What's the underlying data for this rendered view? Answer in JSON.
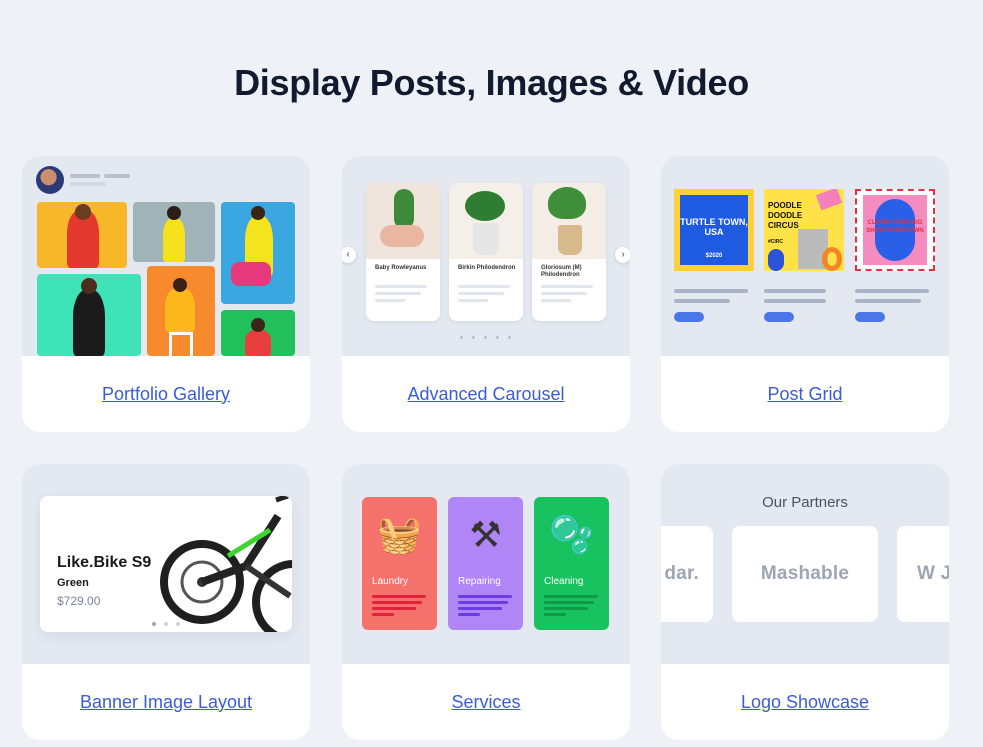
{
  "page": {
    "title": "Display Posts, Images & Video"
  },
  "cards": [
    {
      "label": "Portfolio Gallery"
    },
    {
      "label": "Advanced Carousel"
    },
    {
      "label": "Post Grid"
    },
    {
      "label": "Banner Image Layout"
    },
    {
      "label": "Services"
    },
    {
      "label": "Logo Showcase"
    }
  ],
  "carousel": {
    "plants": [
      {
        "name": "Baby Rowleyanus"
      },
      {
        "name": "Birkin Philodendron"
      },
      {
        "name": "Gloriosum (M) Philodendron"
      }
    ],
    "prev_icon": "chevron-left-icon",
    "next_icon": "chevron-right-icon"
  },
  "post_grid": {
    "posters": [
      {
        "title": "TURTLE TOWN, USA",
        "sub": "$2020",
        "color": "#1f5be0"
      },
      {
        "title": "POODLE DOODLE CIRCUS",
        "sub": "#CIRC",
        "color": "#ffe247"
      },
      {
        "title": "CLOWN TOWN BIG SHOW DOWNTOWN",
        "sub": "",
        "color": "#f58cc0"
      }
    ]
  },
  "banner": {
    "product": "Like.Bike S9",
    "color": "Green",
    "price": "$729.00"
  },
  "services": [
    {
      "label": "Laundry",
      "color": "#f4726b",
      "icon": "laundry-basket-icon",
      "glyph": "🧺"
    },
    {
      "label": "Repairing",
      "color": "#b085f5",
      "icon": "hammer-pick-icon",
      "glyph": "⚒"
    },
    {
      "label": "Cleaning",
      "color": "#18c35f",
      "icon": "soap-bubbles-icon",
      "glyph": "🫧"
    }
  ],
  "logo_showcase": {
    "heading": "Our Partners",
    "logos": [
      "dar.",
      "Mashable",
      "W J"
    ]
  }
}
